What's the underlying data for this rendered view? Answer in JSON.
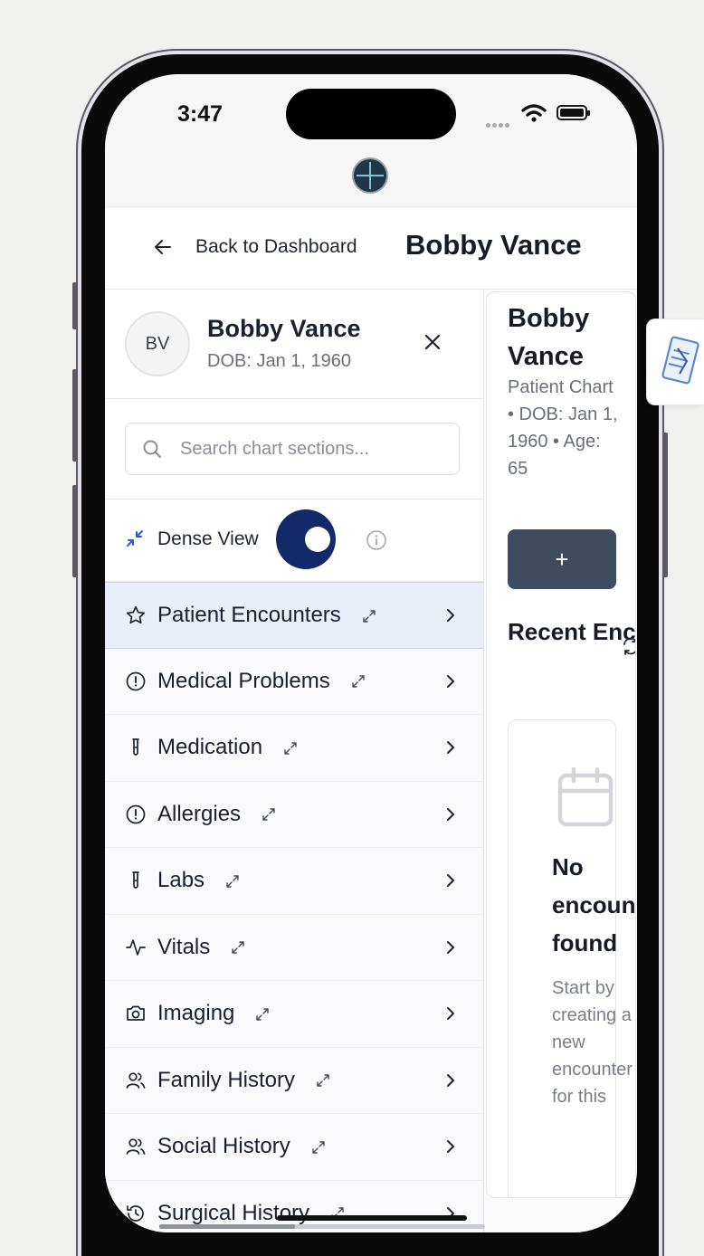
{
  "status_bar": {
    "time": "3:47"
  },
  "topbar": {
    "back_label": "Back to Dashboard",
    "title": "Bobby Vance"
  },
  "patient": {
    "initials": "BV",
    "name": "Bobby Vance",
    "dob": "DOB: Jan 1, 1960"
  },
  "search": {
    "placeholder": "Search chart sections..."
  },
  "dense_view": {
    "label": "Dense View",
    "enabled": true
  },
  "nav_items": [
    {
      "label": "Patient Encounters",
      "icon": "star-icon",
      "active": true
    },
    {
      "label": "Medical Problems",
      "icon": "alert-circle-icon",
      "active": false
    },
    {
      "label": "Medication",
      "icon": "test-tube-icon",
      "active": false
    },
    {
      "label": "Allergies",
      "icon": "alert-circle-icon",
      "active": false
    },
    {
      "label": "Labs",
      "icon": "test-tube-icon",
      "active": false
    },
    {
      "label": "Vitals",
      "icon": "activity-icon",
      "active": false
    },
    {
      "label": "Imaging",
      "icon": "camera-icon",
      "active": false
    },
    {
      "label": "Family History",
      "icon": "users-icon",
      "active": false
    },
    {
      "label": "Social History",
      "icon": "users-icon",
      "active": false
    },
    {
      "label": "Surgical History",
      "icon": "history-icon",
      "active": false
    }
  ],
  "main": {
    "name": "Bobby Vance",
    "subtitle": "Patient Chart • DOB: Jan 1, 1960 • Age: 65",
    "add_button": "+",
    "recent_title": "Recent Encounters",
    "empty_title": "No encounters found",
    "empty_subtitle": "Start by creating a new encounter for this"
  },
  "colors": {
    "accent": "#13296a",
    "active_bg": "#e9eef9",
    "button_dark": "#3f4b5e"
  }
}
